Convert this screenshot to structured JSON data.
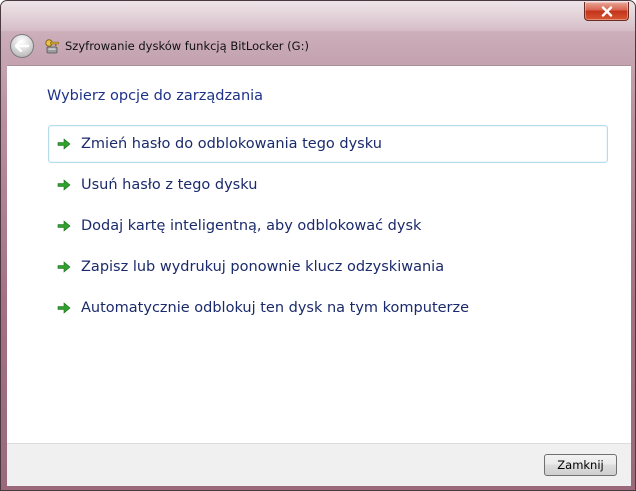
{
  "window": {
    "title": "Szyfrowanie dysków funkcją BitLocker (G:)",
    "close_icon": "close-icon",
    "back_icon": "back-arrow-icon",
    "app_icon": "bitlocker-keys-icon"
  },
  "main": {
    "heading": "Wybierz opcje do zarządzania",
    "options": [
      {
        "label": "Zmień hasło do odblokowania tego dysku",
        "icon": "green-arrow-icon",
        "highlighted": true
      },
      {
        "label": "Usuń hasło z tego dysku",
        "icon": "green-arrow-icon"
      },
      {
        "label": "Dodaj kartę inteligentną, aby odblokować dysk",
        "icon": "green-arrow-icon"
      },
      {
        "label": "Zapisz lub wydrukuj ponownie klucz odzyskiwania",
        "icon": "green-arrow-icon"
      },
      {
        "label": "Automatycznie odblokuj ten dysk na tym komputerze",
        "icon": "green-arrow-icon"
      }
    ]
  },
  "footer": {
    "close_button_label": "Zamknij"
  },
  "colors": {
    "link_text": "#1b2a6b",
    "heading_text": "#1e3287",
    "arrow_green": "#2fa12f",
    "hover_border": "#b7dcec"
  }
}
